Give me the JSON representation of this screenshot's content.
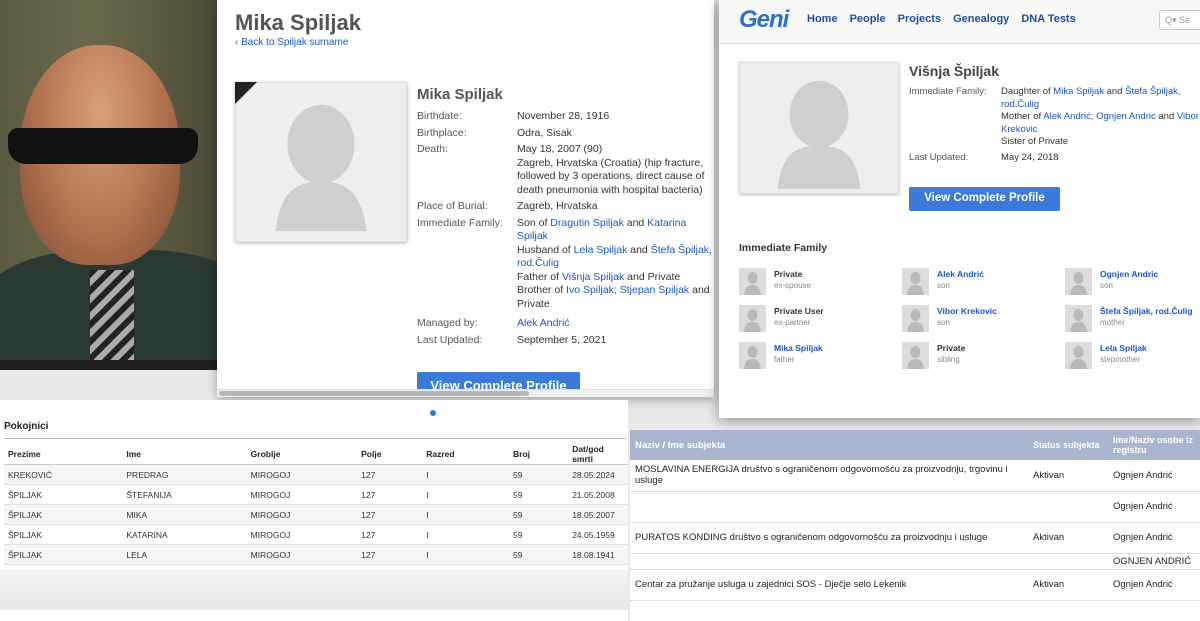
{
  "profile": {
    "title": "Mika Spiljak",
    "back_link": "‹ Back to Spiljak surname",
    "name": "Mika Spiljak",
    "facts": [
      {
        "label": "Birthdate:",
        "parts": [
          {
            "t": "November 28, 1916"
          }
        ]
      },
      {
        "label": "Birthplace:",
        "parts": [
          {
            "t": "Odra, Sisak"
          }
        ]
      },
      {
        "label": "Death:",
        "parts": [
          {
            "t": "May 18, 2007 (90)\nZagreb, Hrvatska (Croatia) (hip fracture, followed by 3 operations, direct cause of death pneumonia with hospital bacteria)"
          }
        ]
      },
      {
        "label": "Place of Burial:",
        "parts": [
          {
            "t": "Zagreb, Hrvatska"
          }
        ]
      },
      {
        "label": "Immediate Family:",
        "parts": [
          {
            "t": "Son of "
          },
          {
            "t": "Dragutin Spiljak",
            "link": true
          },
          {
            "t": " and "
          },
          {
            "t": "Katarina Spiljak",
            "link": true
          },
          {
            "t": "\nHusband of "
          },
          {
            "t": "Lela Spiljak",
            "link": true
          },
          {
            "t": " and "
          },
          {
            "t": "Štefa Špiljak, rod.Čulig",
            "link": true
          },
          {
            "t": "\nFather of "
          },
          {
            "t": "Višnja Spiljak",
            "link": true
          },
          {
            "t": " and Private"
          },
          {
            "t": "\nBrother of "
          },
          {
            "t": "Ivo Spiljak; Stjepan Spiljak",
            "link": true
          },
          {
            "t": " and Private"
          }
        ]
      },
      {
        "label": "",
        "parts": [
          {
            "t": " "
          }
        ]
      },
      {
        "label": "Managed by:",
        "parts": [
          {
            "t": "Alek Andrić",
            "link": true
          }
        ]
      },
      {
        "label": "Last Updated:",
        "parts": [
          {
            "t": "September 5, 2021"
          }
        ]
      }
    ],
    "view_button": "View Complete Profile"
  },
  "geni": {
    "logo": "Geni",
    "nav": [
      "Home",
      "People",
      "Projects",
      "Genealogy",
      "DNA Tests"
    ],
    "search_placeholder": "Se",
    "name": "Višnja Špiljak",
    "facts": [
      {
        "label": "Immediate Family:",
        "parts": [
          {
            "t": "Daughter of "
          },
          {
            "t": "Mika Spiljak",
            "link": true
          },
          {
            "t": " and "
          },
          {
            "t": "Štefa Špiljak, rod.Čulig",
            "link": true
          },
          {
            "t": "\nMother of "
          },
          {
            "t": "Alek Andrić",
            "link": true
          },
          {
            "t": "; "
          },
          {
            "t": "Ognjen Andric",
            "link": true
          },
          {
            "t": " and "
          },
          {
            "t": "Vibor Krekovic",
            "link": true
          },
          {
            "t": "\nSister of Private"
          }
        ]
      },
      {
        "label": "Last Updated:",
        "parts": [
          {
            "t": "May 24, 2018"
          }
        ]
      }
    ],
    "view_button": "View Complete Profile",
    "immediate_family_heading": "Immediate Family",
    "members": [
      {
        "name": "Private",
        "rel": "ex-spouse",
        "link": false
      },
      {
        "name": "Alek Andrić",
        "rel": "son",
        "link": true
      },
      {
        "name": "Ognjen Andric",
        "rel": "son",
        "link": true
      },
      {
        "name": "Private User",
        "rel": "ex-partner",
        "link": false
      },
      {
        "name": "Vibor Krekovic",
        "rel": "son",
        "link": true
      },
      {
        "name": "Štefa Špiljak, rod.Čulig",
        "rel": "mother",
        "link": true
      },
      {
        "name": "Mika Spiljak",
        "rel": "father",
        "link": true
      },
      {
        "name": "Private",
        "rel": "sibling",
        "link": false
      },
      {
        "name": "Lela Spiljak",
        "rel": "stepmother",
        "link": true
      }
    ]
  },
  "cemetery": {
    "title": "Pokojnici",
    "columns": [
      "Prezime",
      "Ime",
      "Groblje",
      "Polje",
      "Razred",
      "Broj",
      "Dat/god smrti"
    ],
    "rows": [
      [
        "KREKOVIĆ",
        "PREDRAG",
        "MIROGOJ",
        "127",
        "I",
        "59",
        "28.05.2024"
      ],
      [
        "ŠPILJAK",
        "ŠTEFANIJA",
        "MIROGOJ",
        "127",
        "I",
        "59",
        "21.05.2008"
      ],
      [
        "ŠPILJAK",
        "MIKA",
        "MIROGOJ",
        "127",
        "I",
        "59",
        "18.05.2007"
      ],
      [
        "ŠPILJAK",
        "KATARINA",
        "MIROGOJ",
        "127",
        "I",
        "59",
        "24.05.1959"
      ],
      [
        "ŠPILJAK",
        "LELA",
        "MIROGOJ",
        "127",
        "I",
        "59",
        "18.08.1941"
      ]
    ]
  },
  "registry": {
    "columns": [
      "Naziv / Ime subjekta",
      "Status subjekta",
      "Ime/Naziv osobe iz registru"
    ],
    "rows": [
      [
        "MOSLAVINA ENERGIJA društvo s ograničenom odgovornošću za proizvodnju, trgovinu i usluge",
        "Aktivan",
        "Ognjen Andrić"
      ],
      [
        "",
        "",
        "Ognjen Andrić"
      ],
      [
        "PURATOS KONDING društvo s ograničenom odgovornošću za proizvodnju i usluge",
        "Aktivan",
        "Ognjen Andrić"
      ],
      [
        "",
        "",
        "OGNJEN ANDRIĆ"
      ],
      [
        "Centar za pružanje usluga u zajednici SOS - Dječje selo Lekenik",
        "Aktivan",
        "Ognjen Andrić"
      ]
    ]
  }
}
